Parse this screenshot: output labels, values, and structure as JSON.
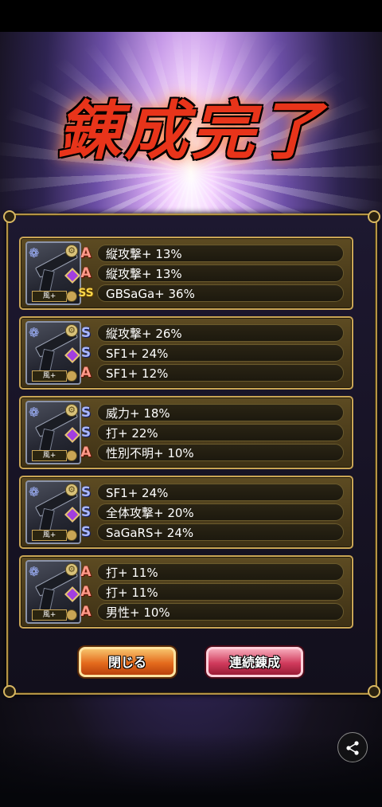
{
  "title": "錬成完了",
  "cards": [
    {
      "element_label": "風+",
      "skills": [
        {
          "rank": "A",
          "text": "縦攻撃+ 13%"
        },
        {
          "rank": "A",
          "text": "縦攻撃+ 13%"
        },
        {
          "rank": "SS",
          "text": "GBSaGa+ 36%"
        }
      ]
    },
    {
      "element_label": "風+",
      "skills": [
        {
          "rank": "S",
          "text": "縦攻撃+ 26%"
        },
        {
          "rank": "S",
          "text": "SF1+ 24%"
        },
        {
          "rank": "A",
          "text": "SF1+ 12%"
        }
      ]
    },
    {
      "element_label": "風+",
      "skills": [
        {
          "rank": "S",
          "text": "威力+ 18%"
        },
        {
          "rank": "S",
          "text": "打+ 22%"
        },
        {
          "rank": "A",
          "text": "性別不明+ 10%"
        }
      ]
    },
    {
      "element_label": "風+",
      "skills": [
        {
          "rank": "S",
          "text": "SF1+ 24%"
        },
        {
          "rank": "S",
          "text": "全体攻撃+ 20%"
        },
        {
          "rank": "S",
          "text": "SaGaRS+ 24%"
        }
      ]
    },
    {
      "element_label": "風+",
      "skills": [
        {
          "rank": "A",
          "text": "打+ 11%"
        },
        {
          "rank": "A",
          "text": "打+ 11%"
        },
        {
          "rank": "A",
          "text": "男性+ 10%"
        }
      ]
    }
  ],
  "buttons": {
    "close_label": "閉じる",
    "repeat_label": "連続錬成"
  },
  "icons": {
    "share": "share-icon",
    "weapon": "gun-icon",
    "gem": "purple-gem-icon"
  },
  "colors": {
    "frame_gold": "#c9a555",
    "rank_a": "#ff9a8a",
    "rank_s": "#aab8ff",
    "rank_ss": "#ffd84a",
    "close_button": "#e46a1c",
    "repeat_button": "#d03a5c"
  }
}
